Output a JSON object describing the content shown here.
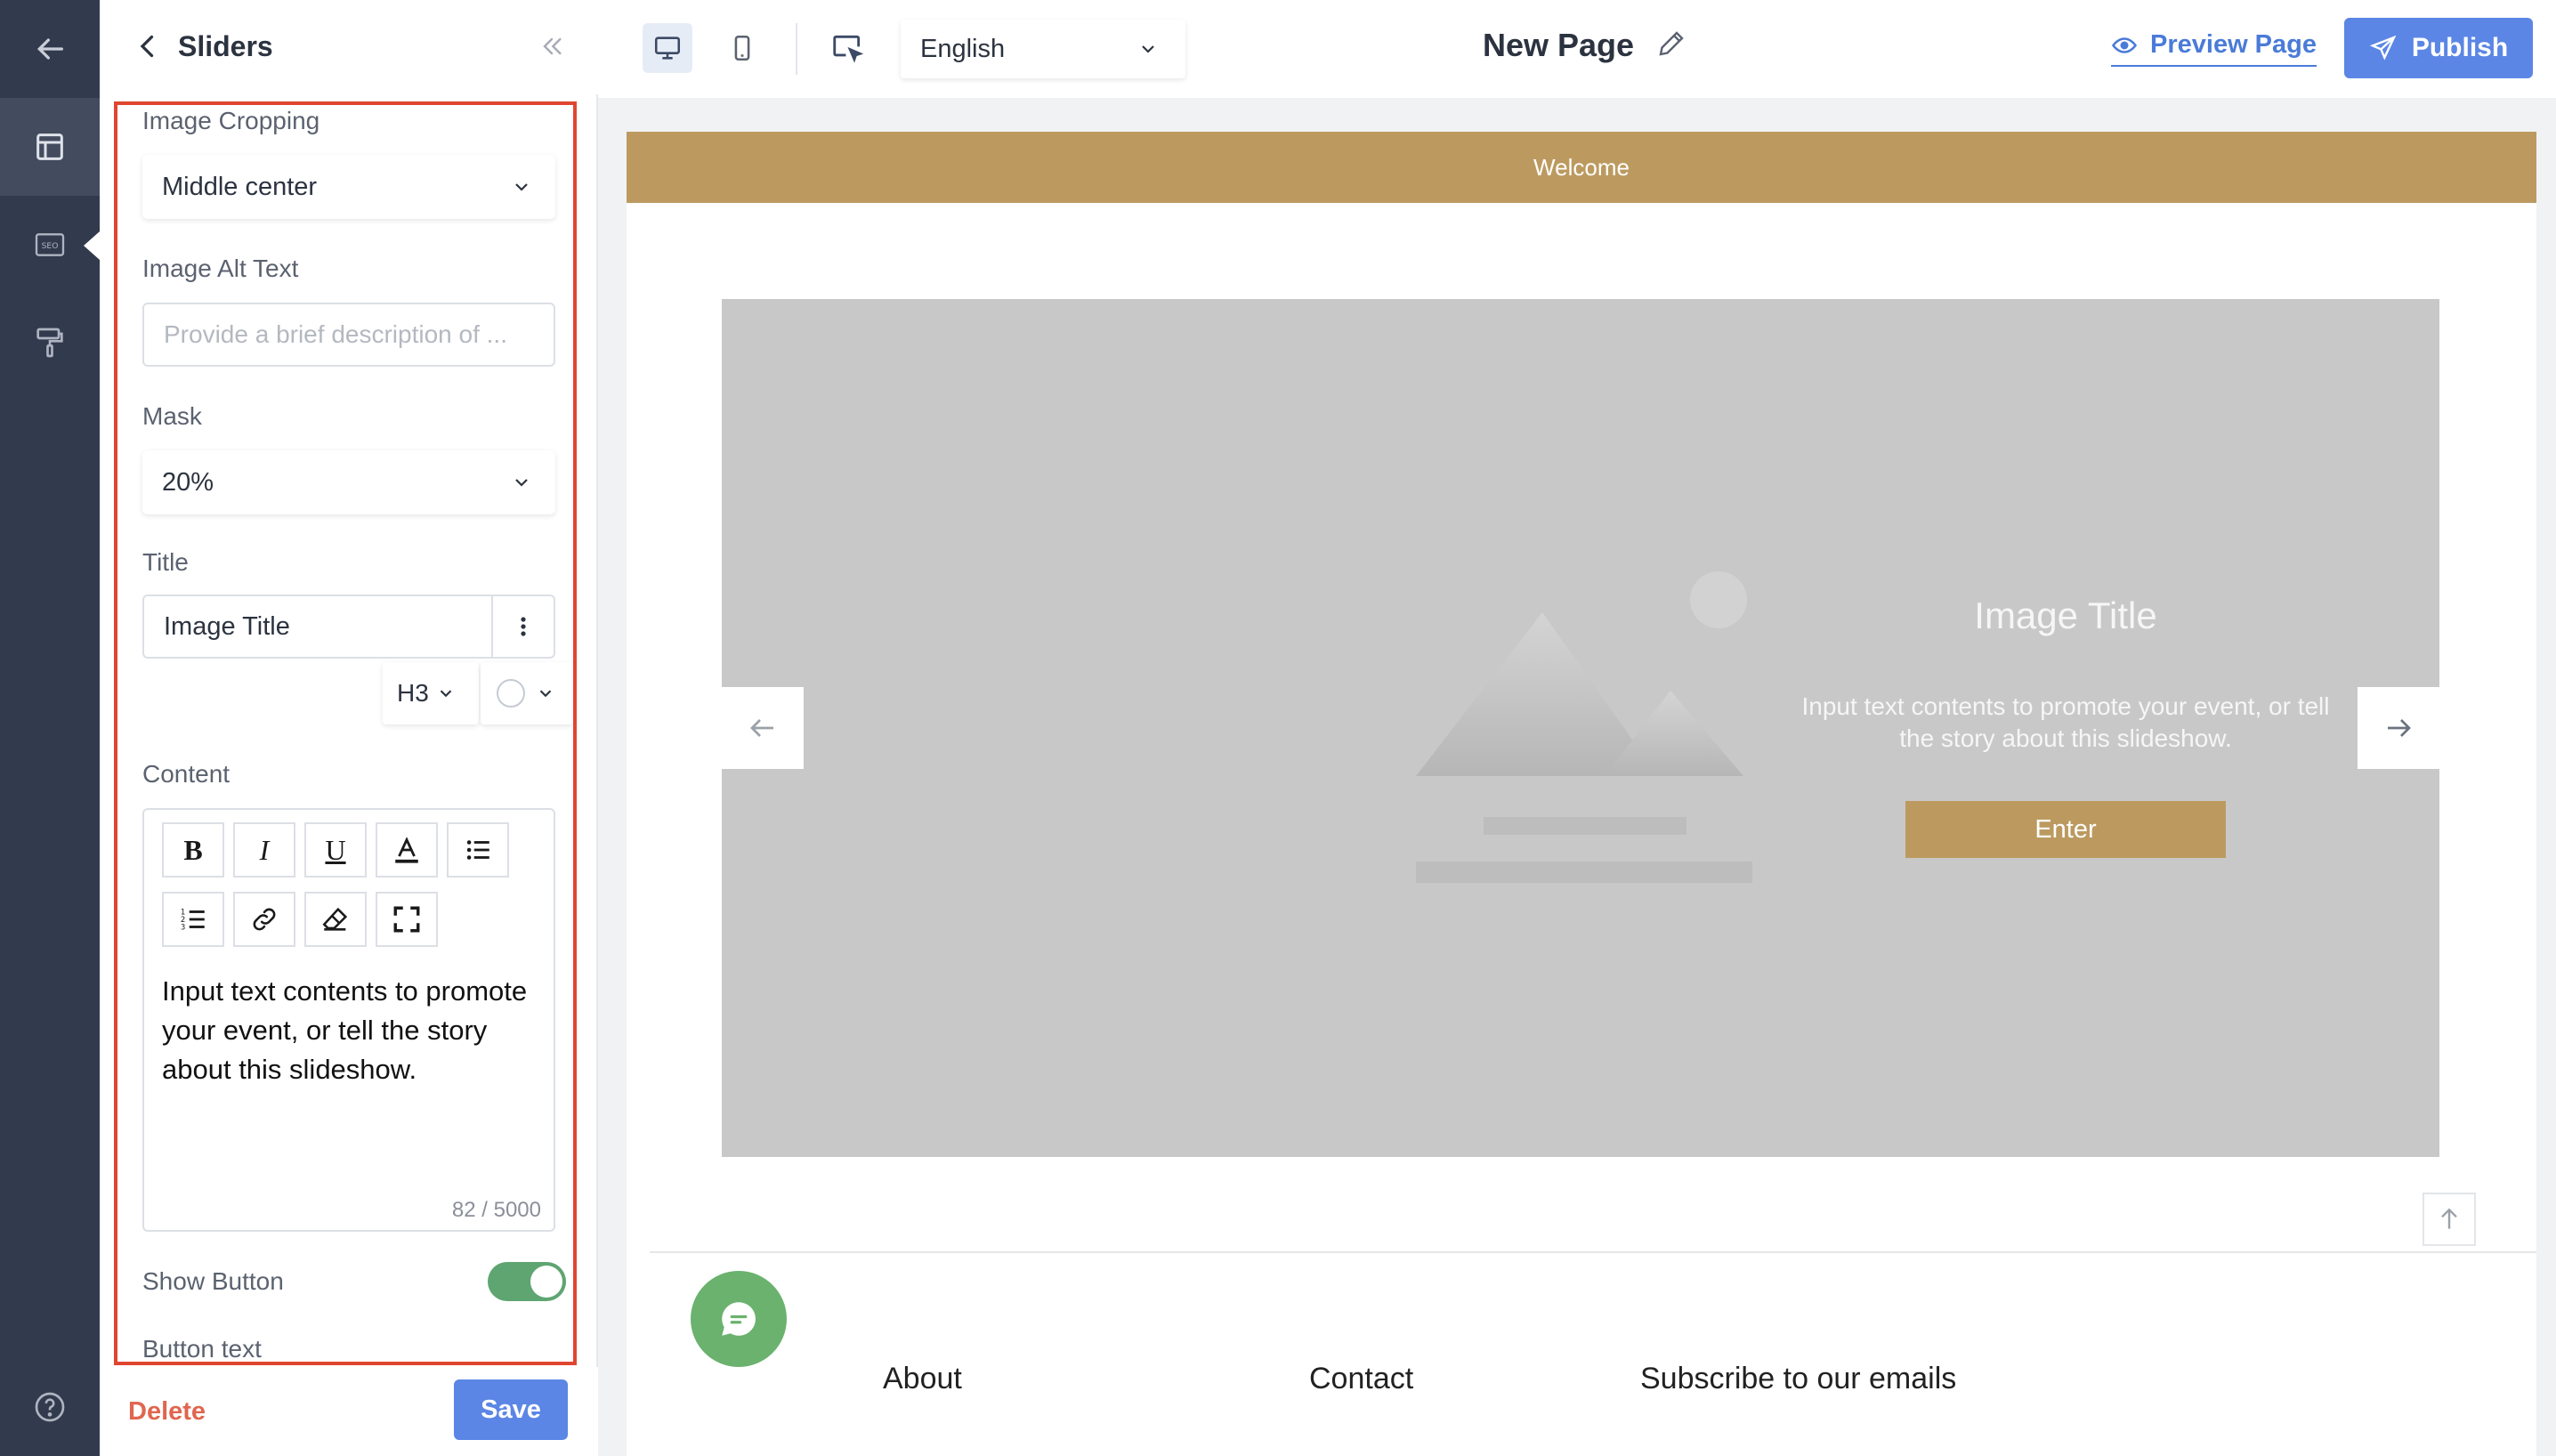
{
  "rail": {
    "items": [
      "back-arrow-icon",
      "layout-icon",
      "seo-icon",
      "paint-roller-icon"
    ],
    "help_icon": "help-icon"
  },
  "panel": {
    "title": "Sliders",
    "image_cropping": {
      "label": "Image Cropping",
      "value": "Middle center"
    },
    "image_alt_text": {
      "label": "Image Alt Text",
      "placeholder": "Provide a brief description of ..."
    },
    "mask": {
      "label": "Mask",
      "value": "20%"
    },
    "title_field": {
      "label": "Title",
      "value": "Image Title",
      "heading_level": "H3"
    },
    "content": {
      "label": "Content",
      "toolbar": [
        "bold",
        "italic",
        "underline",
        "font-color",
        "bulleted-list",
        "numbered-list",
        "link",
        "clear-format",
        "fullscreen"
      ],
      "text": "Input text contents to promote your event, or tell the story about this slideshow.",
      "counter": "82 / 5000"
    },
    "show_button": {
      "label": "Show Button",
      "enabled": true
    },
    "button_text": {
      "label": "Button text"
    },
    "delete_label": "Delete",
    "save_label": "Save"
  },
  "topbar": {
    "language": "English",
    "page_name": "New Page",
    "preview_label": "Preview Page",
    "publish_label": "Publish"
  },
  "canvas": {
    "welcome": "Welcome",
    "slide": {
      "title": "Image Title",
      "text": "Input text contents to promote your event, or tell the story about this slideshow.",
      "button": "Enter"
    },
    "footer": {
      "about": "About",
      "contact": "Contact",
      "subscribe": "Subscribe to our emails"
    }
  },
  "colors": {
    "rail": "#323a4d",
    "accent_gold": "#bc9a5f",
    "primary_blue": "#5b86e5",
    "highlight_red": "#e0462f",
    "toggle_green": "#5fa572"
  }
}
